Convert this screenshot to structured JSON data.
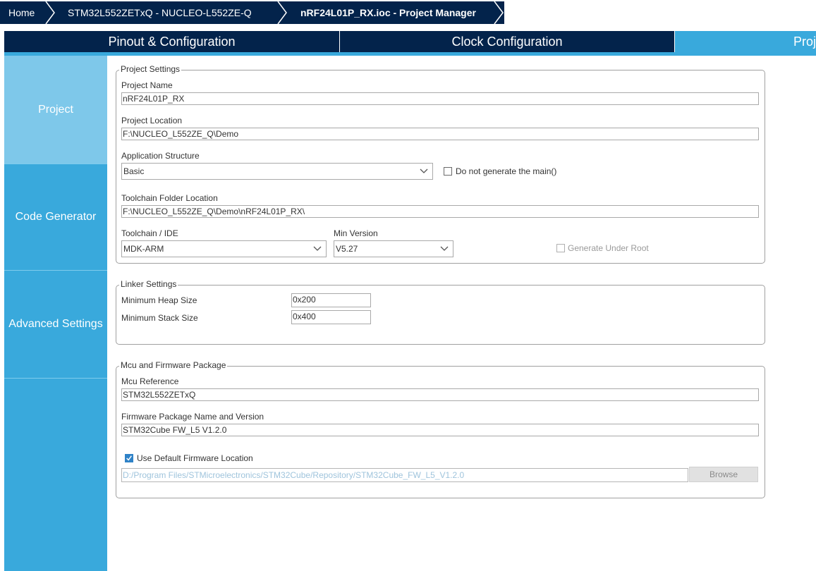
{
  "breadcrumb": {
    "home": "Home",
    "board": "STM32L552ZETxQ  -  NUCLEO-L552ZE-Q",
    "current": "nRF24L01P_RX.ioc - Project Manager"
  },
  "tabs": [
    {
      "label": "Pinout & Configuration"
    },
    {
      "label": "Clock Configuration"
    },
    {
      "label": "Project Manager"
    }
  ],
  "sidebar": {
    "items": [
      {
        "label": "Project"
      },
      {
        "label": "Code Generator"
      },
      {
        "label": "Advanced Settings"
      }
    ]
  },
  "project_settings": {
    "title": "Project Settings",
    "project_name_label": "Project Name",
    "project_name_value": "nRF24L01P_RX",
    "project_location_label": "Project Location",
    "project_location_value": "F:\\NUCLEO_L552ZE_Q\\Demo",
    "app_structure_label": "Application Structure",
    "app_structure_value": "Basic",
    "no_main_label": "Do not generate the main()",
    "toolchain_folder_label": "Toolchain Folder Location",
    "toolchain_folder_value": "F:\\NUCLEO_L552ZE_Q\\Demo\\nRF24L01P_RX\\",
    "toolchain_ide_label": "Toolchain / IDE",
    "toolchain_ide_value": "MDK-ARM",
    "min_version_label": "Min Version",
    "min_version_value": "V5.27",
    "gen_under_root_label": "Generate Under Root"
  },
  "linker_settings": {
    "title": "Linker Settings",
    "heap_label": "Minimum Heap Size",
    "heap_value": "0x200",
    "stack_label": "Minimum Stack Size",
    "stack_value": "0x400"
  },
  "mcu_firmware": {
    "title": "Mcu and Firmware Package",
    "mcu_ref_label": "Mcu Reference",
    "mcu_ref_value": "STM32L552ZETxQ",
    "fw_pkg_label": "Firmware Package Name and Version",
    "fw_pkg_value": "STM32Cube FW_L5 V1.2.0",
    "use_default_label": "Use Default Firmware Location",
    "fw_location_value": "D:/Program Files/STMicroelectronics/STM32Cube/Repository/STM32Cube_FW_L5_V1.2.0",
    "browse_label": "Browse"
  },
  "colors": {
    "navy": "#03234b",
    "accent": "#39a9dc",
    "sidebar_active": "#7ec8ea"
  }
}
